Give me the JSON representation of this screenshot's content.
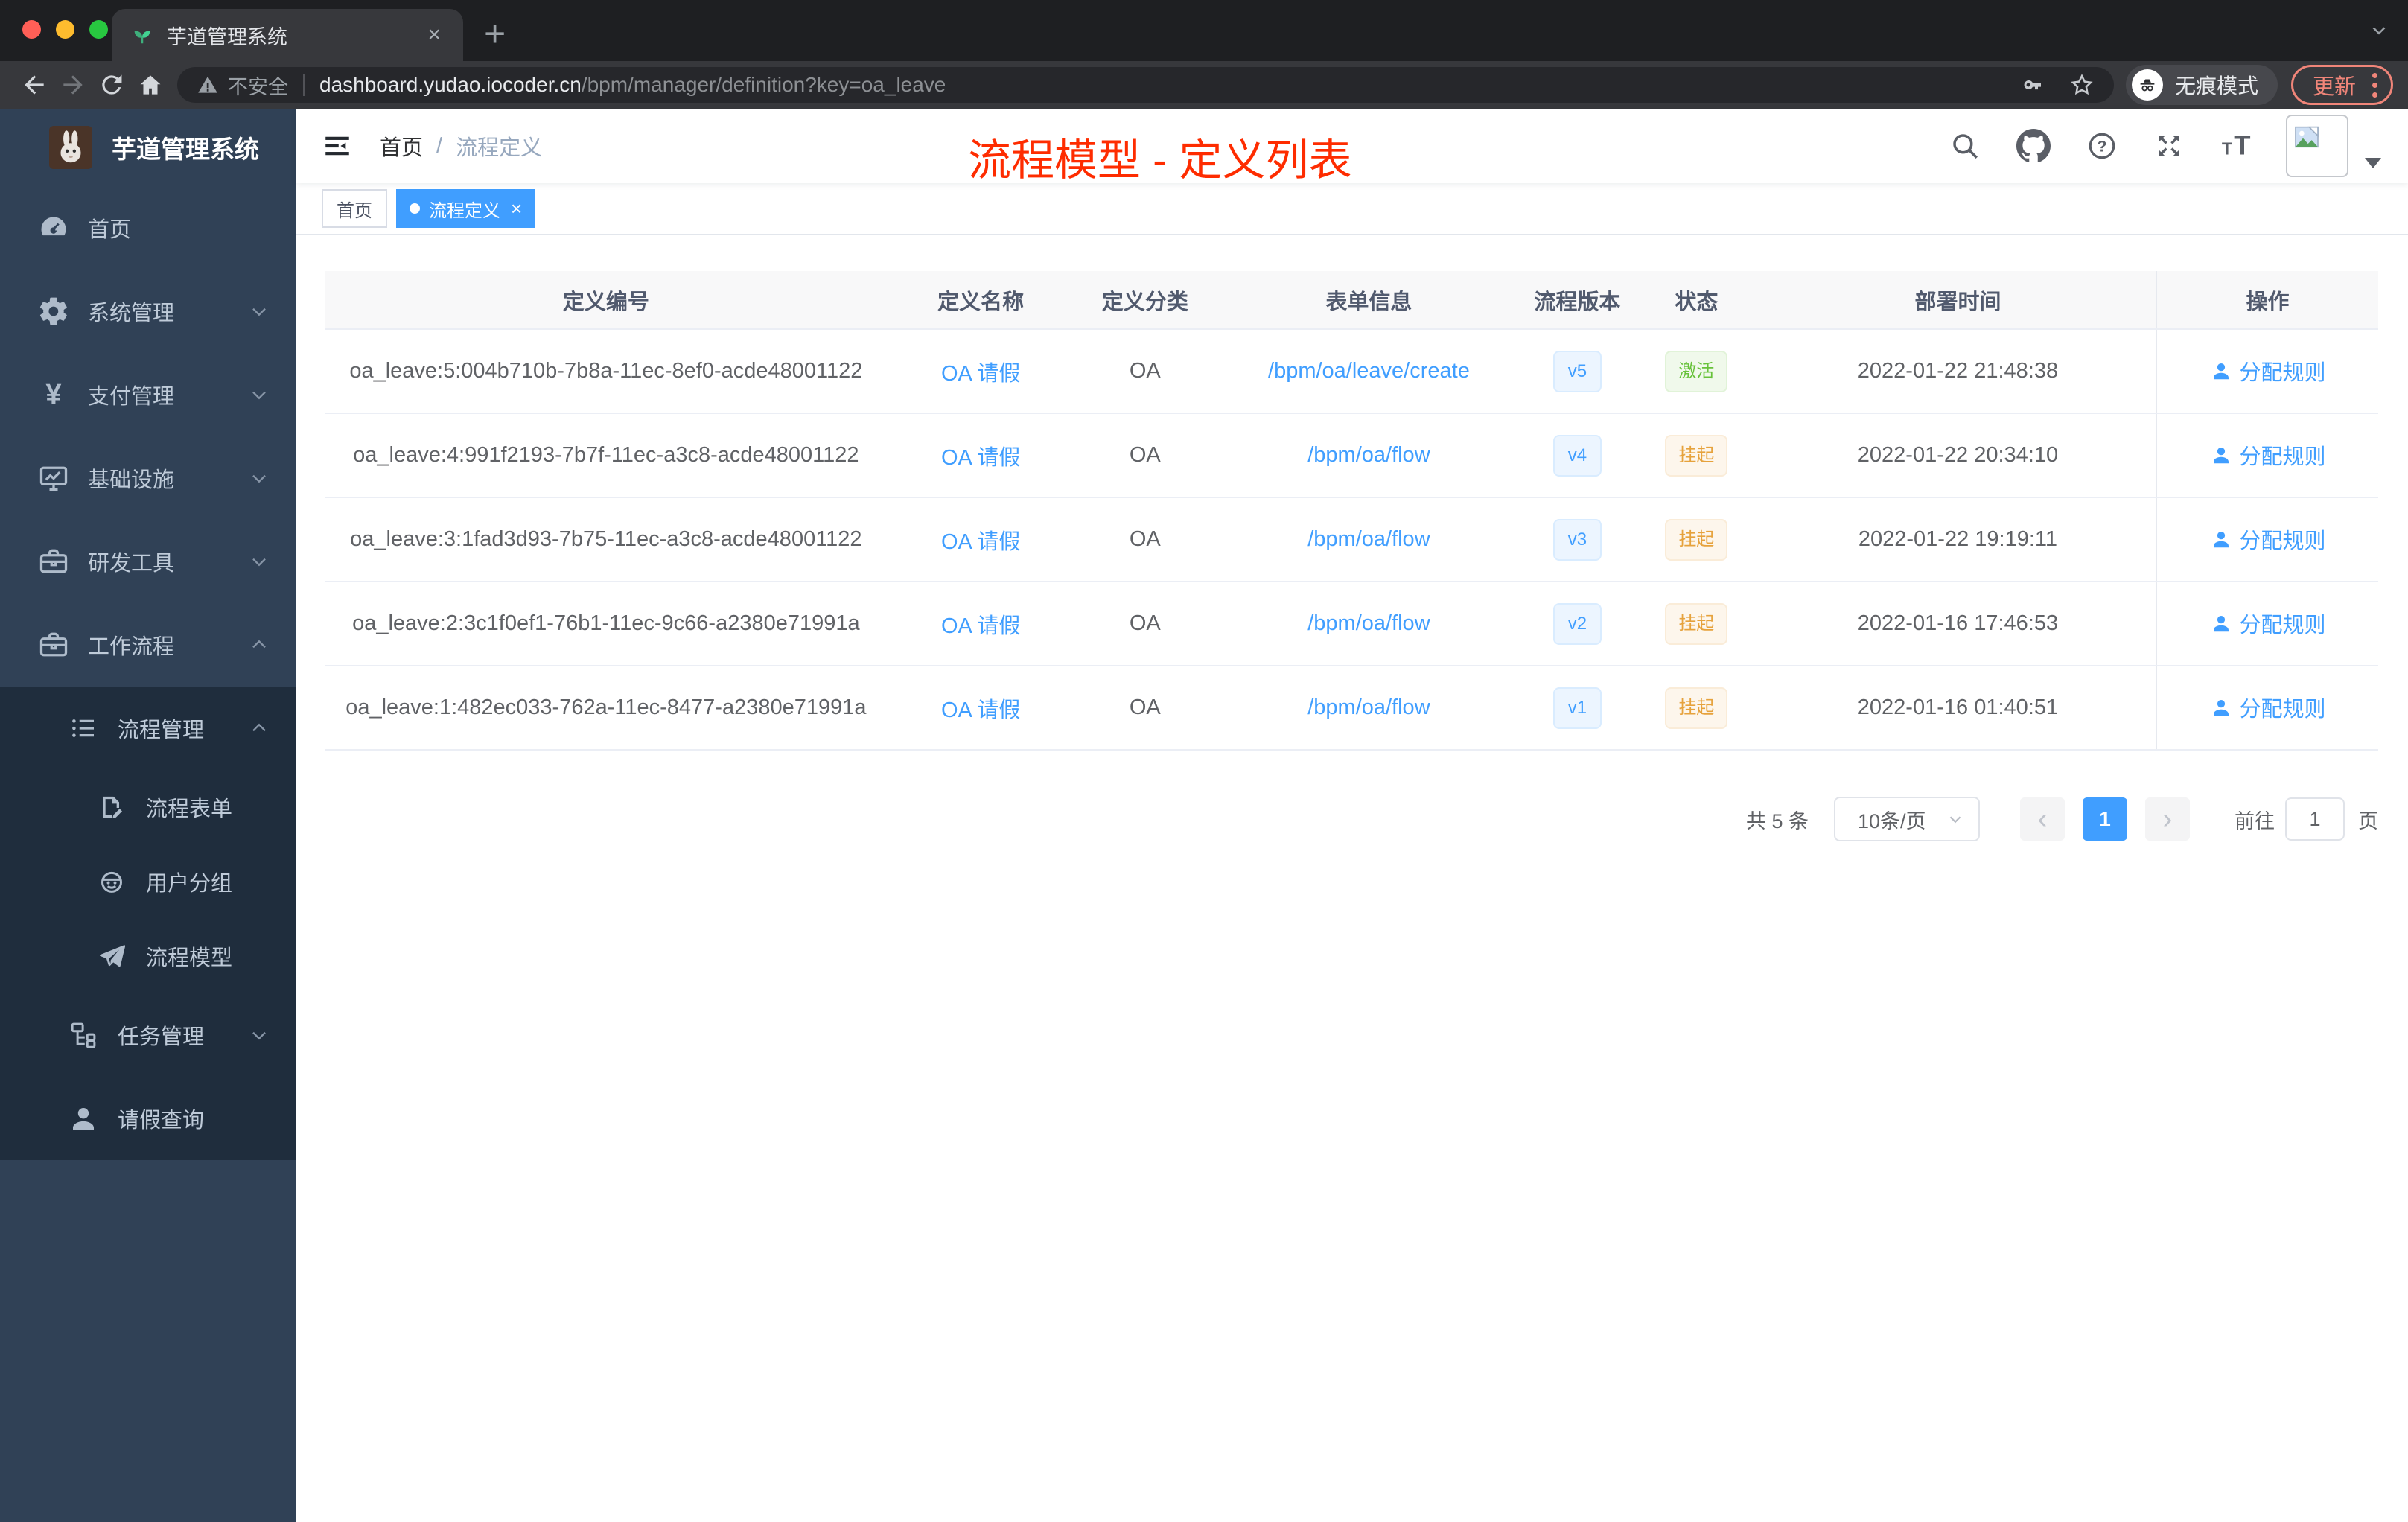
{
  "browser": {
    "traffic_lights": {
      "close": "#ff5f57",
      "minimize": "#febc2e",
      "zoom": "#28c840"
    },
    "tab_title": "芋道管理系统",
    "tab_close_glyph": "×",
    "new_tab_glyph": "+",
    "security_label": "不安全",
    "url_host": "dashboard.yudao.iocoder.cn",
    "url_path": "/bpm/manager/definition?key=oa_leave",
    "incognito_label": "无痕模式",
    "update_label": "更新"
  },
  "sidebar": {
    "logo_title": "芋道管理系统",
    "items": [
      {
        "label": "首页",
        "icon": "dashboard-icon"
      },
      {
        "label": "系统管理",
        "icon": "gear-icon",
        "chevron": "down"
      },
      {
        "label": "支付管理",
        "icon": "yen-icon",
        "chevron": "down"
      },
      {
        "label": "基础设施",
        "icon": "monitor-icon",
        "chevron": "down"
      },
      {
        "label": "研发工具",
        "icon": "toolbox-icon",
        "chevron": "down"
      },
      {
        "label": "工作流程",
        "icon": "toolbox-icon",
        "chevron": "up"
      },
      {
        "label": "流程管理",
        "icon": "list-icon",
        "chevron": "up",
        "level": 2
      },
      {
        "label": "流程表单",
        "icon": "form-icon",
        "level": 3
      },
      {
        "label": "用户分组",
        "icon": "robot-icon",
        "level": 3
      },
      {
        "label": "流程模型",
        "icon": "send-icon",
        "level": 3
      },
      {
        "label": "任务管理",
        "icon": "tree-icon",
        "chevron": "down",
        "level": 2
      },
      {
        "label": "请假查询",
        "icon": "user-icon",
        "level": 2
      }
    ]
  },
  "navbar": {
    "breadcrumb": {
      "home": "首页",
      "separator": "/",
      "current": "流程定义"
    },
    "annotation": "流程模型 - 定义列表",
    "annotation_color": "#fe2c00"
  },
  "tags": {
    "home": "首页",
    "active": "流程定义",
    "close_glyph": "×"
  },
  "table": {
    "columns": [
      "定义编号",
      "定义名称",
      "定义分类",
      "表单信息",
      "流程版本",
      "状态",
      "部署时间",
      "操作"
    ],
    "link_color": "#409eff",
    "status_colors": {
      "激活": "#67c23a",
      "挂起": "#e6a23c"
    },
    "rows": [
      {
        "id": "oa_leave:5:004b710b-7b8a-11ec-8ef0-acde48001122",
        "name": "OA 请假",
        "category": "OA",
        "form": "/bpm/oa/leave/create",
        "version": "v5",
        "status": "激活",
        "time": "2022-01-22 21:48:38",
        "action": "分配规则"
      },
      {
        "id": "oa_leave:4:991f2193-7b7f-11ec-a3c8-acde48001122",
        "name": "OA 请假",
        "category": "OA",
        "form": "/bpm/oa/flow",
        "version": "v4",
        "status": "挂起",
        "time": "2022-01-22 20:34:10",
        "action": "分配规则"
      },
      {
        "id": "oa_leave:3:1fad3d93-7b75-11ec-a3c8-acde48001122",
        "name": "OA 请假",
        "category": "OA",
        "form": "/bpm/oa/flow",
        "version": "v3",
        "status": "挂起",
        "time": "2022-01-22 19:19:11",
        "action": "分配规则"
      },
      {
        "id": "oa_leave:2:3c1f0ef1-76b1-11ec-9c66-a2380e71991a",
        "name": "OA 请假",
        "category": "OA",
        "form": "/bpm/oa/flow",
        "version": "v2",
        "status": "挂起",
        "time": "2022-01-16 17:46:53",
        "action": "分配规则"
      },
      {
        "id": "oa_leave:1:482ec033-762a-11ec-8477-a2380e71991a",
        "name": "OA 请假",
        "category": "OA",
        "form": "/bpm/oa/flow",
        "version": "v1",
        "status": "挂起",
        "time": "2022-01-16 01:40:51",
        "action": "分配规则"
      }
    ]
  },
  "pagination": {
    "total": "共 5 条",
    "page_size": "10条/页",
    "prev_glyph": "‹",
    "current_page": "1",
    "next_glyph": "›",
    "goto_label": "前往",
    "goto_value": "1",
    "page_unit": "页"
  }
}
